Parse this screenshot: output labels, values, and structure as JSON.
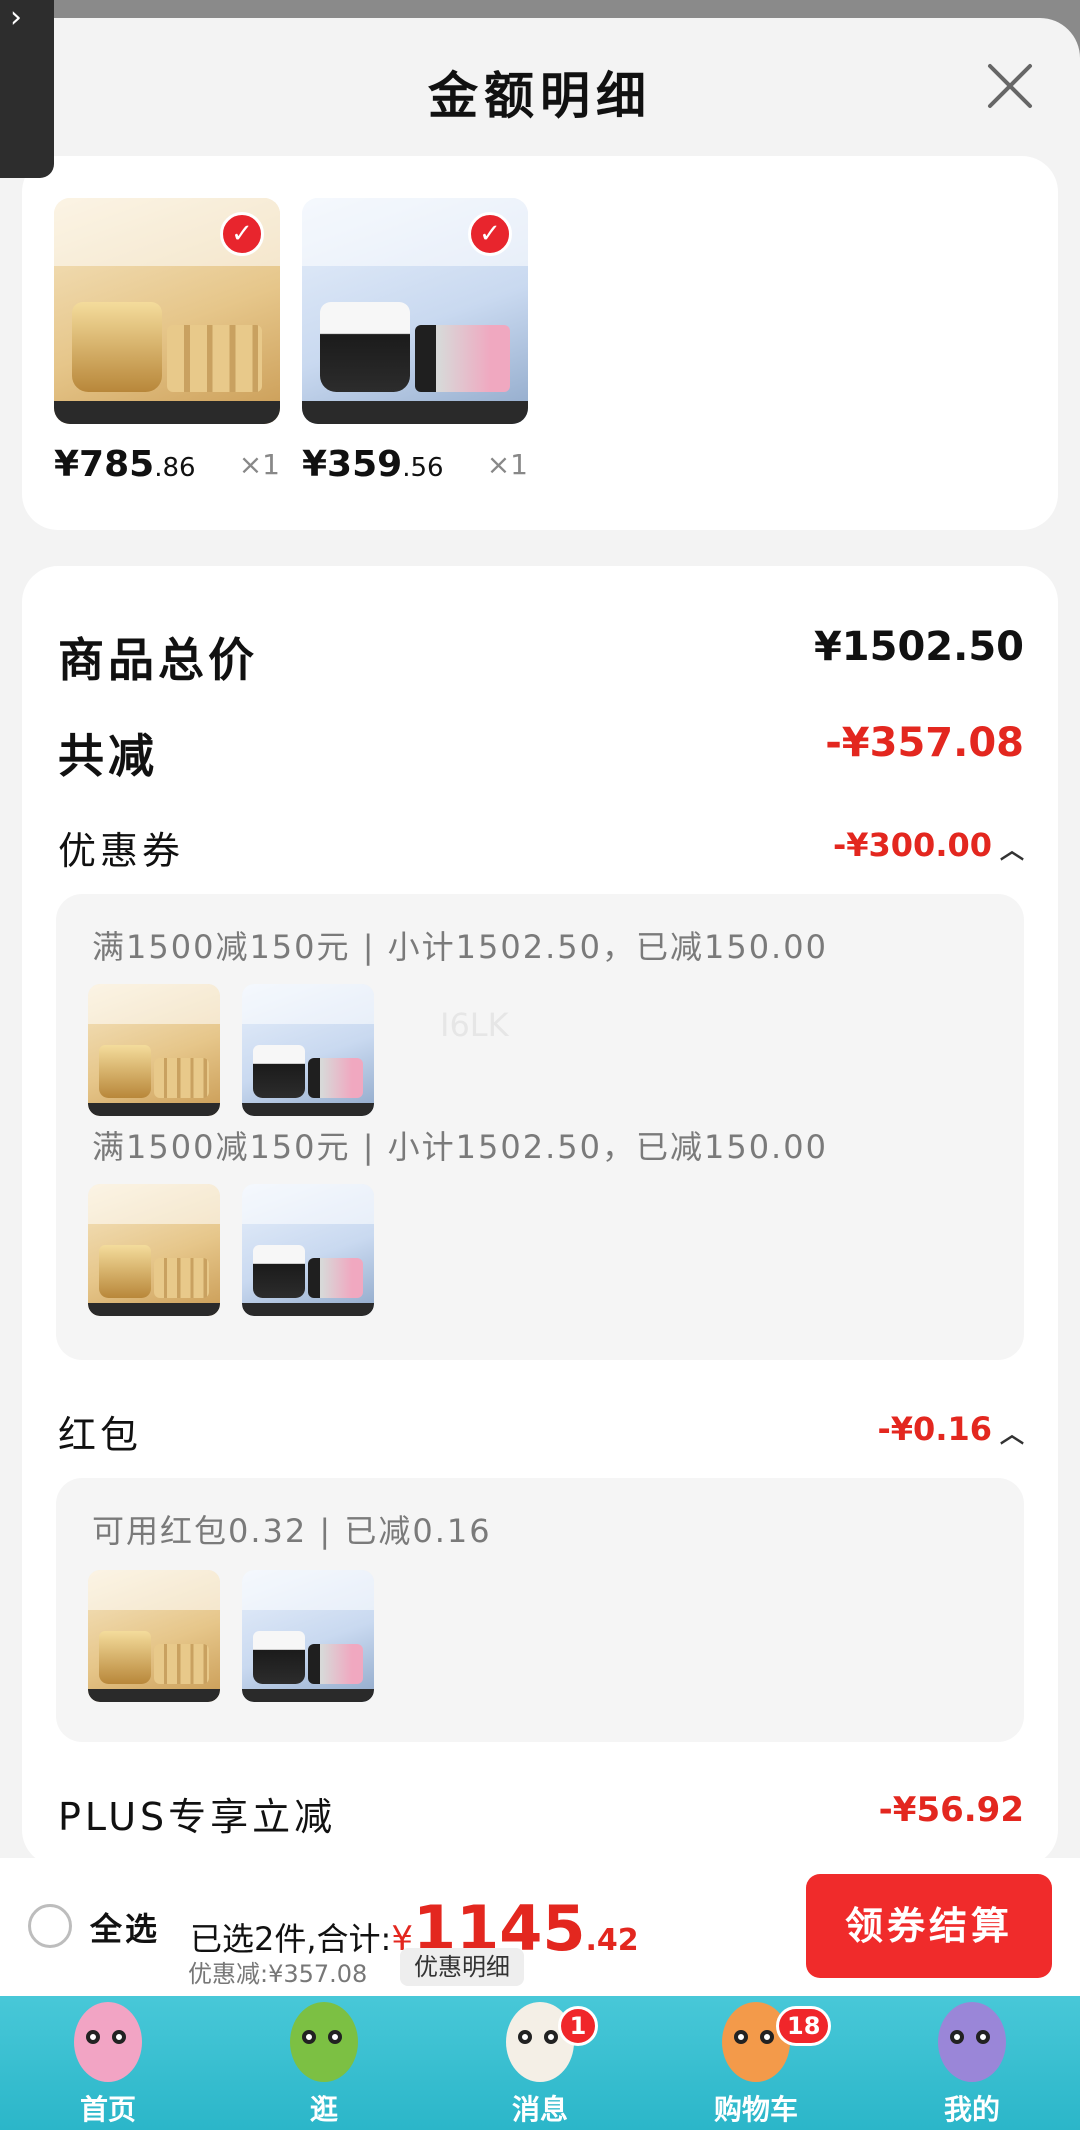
{
  "sheet": {
    "title": "金额明细"
  },
  "products": [
    {
      "price_int": "¥785",
      "price_dec": ".86",
      "qty": "×1",
      "style": "gold"
    },
    {
      "price_int": "¥359",
      "price_dec": ".56",
      "qty": "×1",
      "style": "blue"
    }
  ],
  "summary": {
    "total_label": "商品总价",
    "total_value": "¥1502.50",
    "reduce_label": "共减",
    "reduce_value": "-¥357.08"
  },
  "coupons": {
    "label": "优惠券",
    "value": "-¥300.00",
    "rules": [
      "满1500减150元 | 小计1502.50，已减150.00",
      "满1500减150元 | 小计1502.50，已减150.00"
    ]
  },
  "redpacket": {
    "label": "红包",
    "value": "-¥0.16",
    "rule": "可用红包0.32 | 已减0.16"
  },
  "plus": {
    "label": "PLUS专享立减",
    "value": "-¥56.92"
  },
  "watermark": "I6LK",
  "checkout": {
    "select_all": "全选",
    "selected_text": "已选2件,合计:",
    "currency": "¥",
    "total_int": "1145",
    "total_dec": ".42",
    "discount_text": "优惠减:¥357.08",
    "detail_button": "优惠明细",
    "checkout_button": "领券结算"
  },
  "tabbar": {
    "items": [
      {
        "label": "首页",
        "icon": "pink-bird-icon",
        "color": "#f2a4c4"
      },
      {
        "label": "逛",
        "icon": "green-bird-icon",
        "color": "#7cc043"
      },
      {
        "label": "消息",
        "icon": "white-bird-icon",
        "color": "#f4efe6",
        "badge": "1"
      },
      {
        "label": "购物车",
        "icon": "orange-bird-icon",
        "color": "#f39a4a",
        "badge": "18"
      },
      {
        "label": "我的",
        "icon": "purple-bird-icon",
        "color": "#9a86d8"
      }
    ]
  },
  "colors": {
    "accent_red": "#e3271f",
    "button_red": "#f02b2b",
    "tabbar": "#2bb6c9"
  }
}
